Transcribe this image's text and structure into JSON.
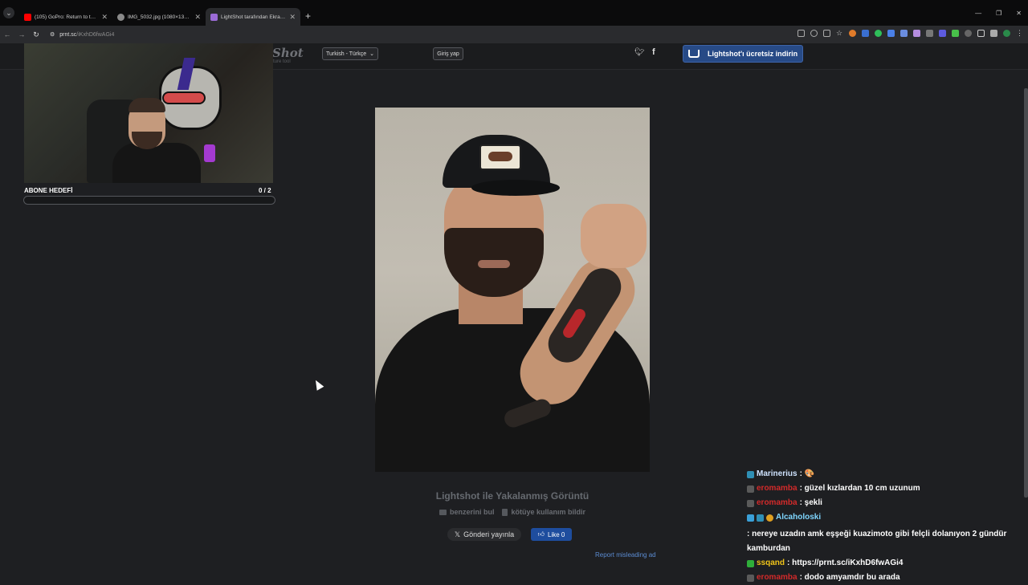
{
  "browser": {
    "tabs": [
      {
        "title": "(105) GoPro: Return to the Dit…",
        "favicon_color": "#ff0000"
      },
      {
        "title": "IMG_5032.jpg (1080×1350)",
        "favicon_color": "#8a8a8a"
      },
      {
        "title": "LightShot tarafından Ekran Gö…",
        "favicon_color": "#9b6bd6"
      }
    ],
    "new_tab": "+",
    "url_host": "prnt.sc",
    "url_path": "/iKxhD6fwAGi4"
  },
  "lightshot": {
    "logo": "Shot",
    "logo_sub": "ture tool",
    "language": "Turkish - Türkçe",
    "login": "Giriş yap",
    "download": "Lightshot'ı ücretsiz indirin",
    "caption": "Lightshot ile Yakalanmış Görüntü",
    "find_similar": "benzerini bul",
    "report_abuse": "kötüye kullanım bildir",
    "x_share": "Gönderi yayınla",
    "like": "Like 0",
    "report_ad": "Report misleading ad"
  },
  "overlay": {
    "sub_goal_label": "ABONE HEDEFİ",
    "sub_goal_count": "0  / 2",
    "sub_goal_progress": 0
  },
  "chat": [
    {
      "user": "Marinerius",
      "color": "#cfe3ff",
      "text": ": 🎨"
    },
    {
      "user": "eromamba",
      "color": "#d32a2a",
      "text": ": güzel kızlardan 10 cm uzunum"
    },
    {
      "user": "eromamba",
      "color": "#d32a2a",
      "text": ": şekli"
    },
    {
      "user": "Alcaholoski",
      "color": "#7fd6ff",
      "text": ": nereye uzadın amk eşşeği kuazimoto gibi felçli dolanıyon 2 gündür kamburdan"
    },
    {
      "user": "ssqand",
      "color": "#f0c419",
      "text": ": https://prnt.sc/iKxhD6fwAGi4"
    },
    {
      "user": "eromamba",
      "color": "#d32a2a",
      "text": ": dodo amyamdır bu arada"
    }
  ]
}
